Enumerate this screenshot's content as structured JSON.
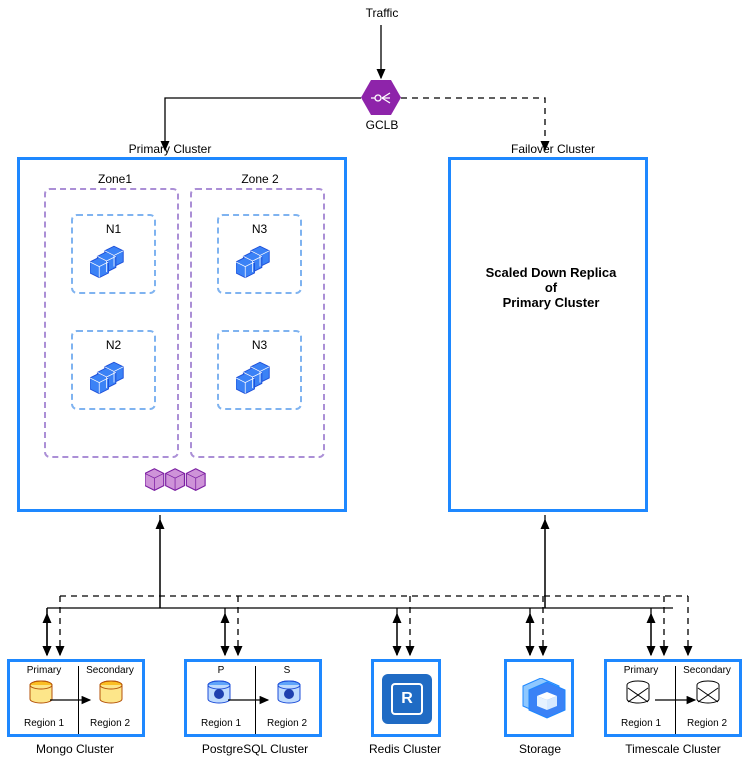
{
  "traffic": {
    "label": "Traffic"
  },
  "lb": {
    "label": "GCLB"
  },
  "primary_cluster": {
    "title": "Primary Cluster",
    "zone1": {
      "title": "Zone1",
      "nodes": [
        {
          "name": "N1"
        },
        {
          "name": "N2"
        }
      ]
    },
    "zone2": {
      "title": "Zone 2",
      "nodes": [
        {
          "name": "N3"
        },
        {
          "name": "N3"
        }
      ]
    }
  },
  "failover_cluster": {
    "title": "Failover Cluster",
    "body_line1": "Scaled Down Replica",
    "body_line2": "of",
    "body_line3": "Primary Cluster"
  },
  "bottom": {
    "mongo": {
      "primary": "Primary",
      "secondary": "Secondary",
      "region1": "Region 1",
      "region2": "Region 2",
      "label": "Mongo Cluster"
    },
    "postgres": {
      "p": "P",
      "s": "S",
      "region1": "Region 1",
      "region2": "Region 2",
      "label": "PostgreSQL Cluster"
    },
    "redis": {
      "label": "Redis Cluster",
      "symbol": "R"
    },
    "storage": {
      "label": "Storage"
    },
    "timescale": {
      "primary": "Primary",
      "secondary": "Secondary",
      "region1": "Region 1",
      "region2": "Region 2",
      "label": "Timescale Cluster"
    }
  }
}
